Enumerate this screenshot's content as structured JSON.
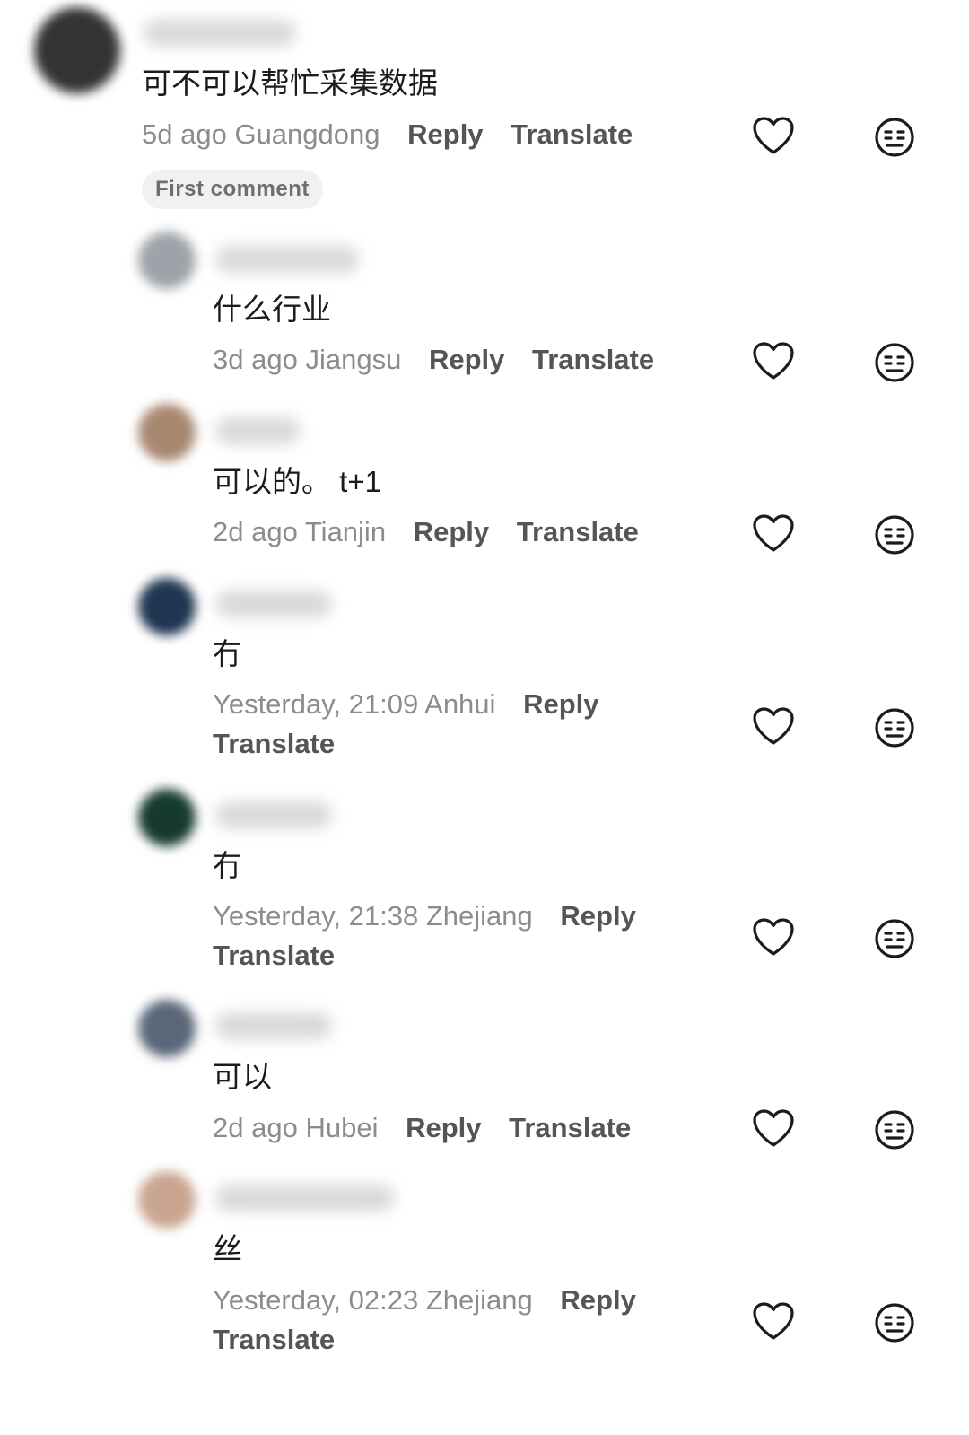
{
  "comments": [
    {
      "username": "",
      "text": "可不可以帮忙采集数据",
      "time": "5d ago",
      "location": "Guangdong",
      "reply_label": "Reply",
      "translate_label": "Translate",
      "badge": "First comment",
      "avatar_color": "#333333"
    },
    {
      "username": "",
      "text": "什么行业",
      "time": "3d ago",
      "location": "Jiangsu",
      "reply_label": "Reply",
      "translate_label": "Translate",
      "avatar_color": "#9ea3aa"
    },
    {
      "username": "",
      "text": "可以的。 t+1",
      "time": "2d ago",
      "location": "Tianjin",
      "reply_label": "Reply",
      "translate_label": "Translate",
      "avatar_color": "#a8876f"
    },
    {
      "username": "",
      "text": "冇",
      "time": "Yesterday, 21:09",
      "location": "Anhui",
      "reply_label": "Reply",
      "translate_label": "Translate",
      "avatar_color": "#1f3552"
    },
    {
      "username": "",
      "text": "冇",
      "time": "Yesterday, 21:38",
      "location": "Zhejiang",
      "reply_label": "Reply",
      "translate_label": "Translate",
      "avatar_color": "#163b2c"
    },
    {
      "username": "",
      "text": "可以",
      "time": "2d ago",
      "location": "Hubei",
      "reply_label": "Reply",
      "translate_label": "Translate",
      "avatar_color": "#5a6778"
    },
    {
      "username": "",
      "text": "丝",
      "time": "Yesterday, 02:23",
      "location": "Zhejiang",
      "reply_label": "Reply",
      "translate_label": "Translate",
      "avatar_color": "#c9a58f"
    }
  ],
  "icons": {
    "like": "heart-outline-icon",
    "dislike": "neutral-face-icon"
  },
  "colors": {
    "text": "#1b1b1b",
    "meta": "#8c8c8c",
    "action": "#555555",
    "badge_bg": "#f1f1f1",
    "icon": "#1b1b1b"
  }
}
